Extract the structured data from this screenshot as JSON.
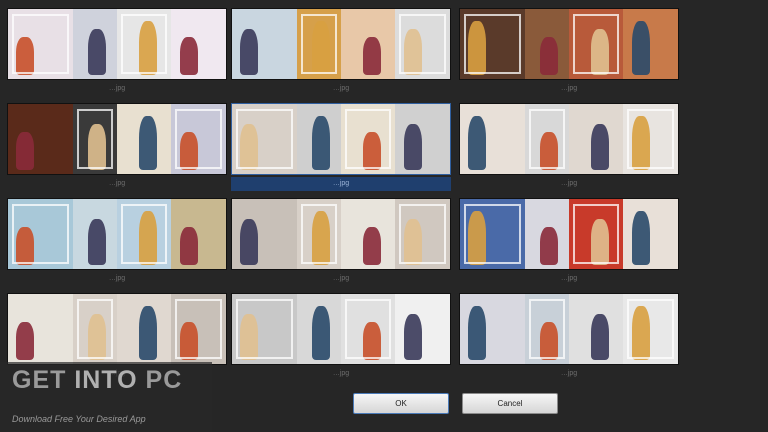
{
  "dialog": {
    "ok_label": "OK",
    "cancel_label": "Cancel"
  },
  "thumbnails": [
    {
      "caption": "…jpg",
      "bg": [
        "#e8e0e6",
        "#cfd2dc",
        "#e6e6e6",
        "#f0e8f0"
      ],
      "selected": false
    },
    {
      "caption": "…jpg",
      "bg": [
        "#c9d6e0",
        "#d6a04a",
        "#e8c8a8",
        "#dcdcdc"
      ],
      "selected": false
    },
    {
      "caption": "…jpg",
      "bg": [
        "#5a3a2a",
        "#8a5a3a",
        "#b85a3a",
        "#c87a4a"
      ],
      "selected": false
    },
    {
      "caption": "…jpg",
      "bg": [
        "#5a2a1a",
        "#3a3a3a",
        "#e8e0d0",
        "#c8c8d8"
      ],
      "selected": false
    },
    {
      "caption": "…jpg",
      "bg": [
        "#d8d0c8",
        "#cfcfcf",
        "#e8e0d0",
        "#d0d0d0"
      ],
      "selected": true
    },
    {
      "caption": "…jpg",
      "bg": [
        "#e8e0d8",
        "#d8d8d8",
        "#e0d8d0",
        "#e8e4e0"
      ],
      "selected": false
    },
    {
      "caption": "…jpg",
      "bg": [
        "#a8c8d8",
        "#c8d8e0",
        "#b8d0e0",
        "#c8b890"
      ],
      "selected": false
    },
    {
      "caption": "…jpg",
      "bg": [
        "#c8c0b8",
        "#d8d0c8",
        "#e8e4dc",
        "#d0c8c0"
      ],
      "selected": false
    },
    {
      "caption": "…jpg",
      "bg": [
        "#4a6aa8",
        "#d8d8e0",
        "#c83a2a",
        "#e8e0d8"
      ],
      "selected": false
    },
    {
      "caption": "…jpg",
      "bg": [
        "#e8e4dc",
        "#d8d0c8",
        "#e0d8d0",
        "#c8c0b8"
      ],
      "selected": false
    },
    {
      "caption": "…jpg",
      "bg": [
        "#c8c8c8",
        "#d8d8d8",
        "#e0e0e0",
        "#f0f0f0"
      ],
      "selected": false
    },
    {
      "caption": "…jpg",
      "bg": [
        "#d8d8e0",
        "#c8d0d8",
        "#e0e0e0",
        "#e8e8e8"
      ],
      "selected": false
    }
  ],
  "watermark": {
    "prefix": "GET ",
    "into": "INTO",
    "suffix": " PC",
    "tagline": "Download Free Your Desired App"
  }
}
